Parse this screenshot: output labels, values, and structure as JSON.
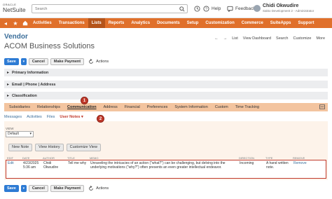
{
  "header": {
    "oracle_label": "ORACLE",
    "netsuite_label": "NetSuite",
    "search_placeholder": "Search",
    "help_label": "Help",
    "feedback_label": "Feedback",
    "user_name": "Chidi Okwudire",
    "user_role": "Sakto Development 2 - Administrator"
  },
  "nav": {
    "items": [
      "Activities",
      "Transactions",
      "Lists",
      "Reports",
      "Analytics",
      "Documents",
      "Setup",
      "Customization",
      "Commerce",
      "SuiteApps",
      "Support"
    ],
    "active_index": 2
  },
  "page": {
    "title": "Vendor",
    "record_name": "ACOM Business Solutions",
    "list_link": "List",
    "view_dashboard_link": "View Dashboard",
    "search_link": "Search",
    "customize_link": "Customize",
    "more_link": "More"
  },
  "buttons": {
    "save": "Save",
    "cancel": "Cancel",
    "make_payment": "Make Payment",
    "actions": "Actions"
  },
  "sections": [
    "Primary Information",
    "Email | Phone | Address",
    "Classification"
  ],
  "subtabs": {
    "items": [
      "Subsidiaries",
      "Relationships",
      "Communication",
      "Address",
      "Financial",
      "Preferences",
      "System Information",
      "Custom",
      "Time Tracking"
    ],
    "active_index": 2
  },
  "subsubtabs": {
    "items": [
      "Messages",
      "Activities",
      "Files",
      "User Notes"
    ],
    "active_index": 3
  },
  "badges": [
    "1",
    "2"
  ],
  "panel": {
    "view_label": "VIEW",
    "view_value": "Default",
    "new_note": "New Note",
    "view_history": "View History",
    "customize_view": "Customize View"
  },
  "table": {
    "columns": [
      "EDIT",
      "DATE",
      "AUTHOR",
      "TITLE",
      "MEMO",
      "DIRECTION",
      "TYPE",
      "REMOVE"
    ],
    "row": {
      "edit": "Edit",
      "date": "4/23/2025 5:36 am",
      "author": "Chidi Okwudire",
      "title": "Tell me why",
      "memo": "Unraveling the intricacies of an action (\"what?\") can be challenging, but delving into the underlying motivations (\"why?\") often presents an even greater intellectual endeavor.",
      "direction": "Incoming",
      "type": "A hand written note.",
      "remove": "Remove"
    }
  },
  "colors": {
    "nav_bg": "#e0702b",
    "nav_active": "#b5541a",
    "subtab_bg": "#f3c49f",
    "primary_button": "#2d7bd4",
    "title_blue": "#3b6e9a",
    "highlight_red": "#c0392b"
  }
}
